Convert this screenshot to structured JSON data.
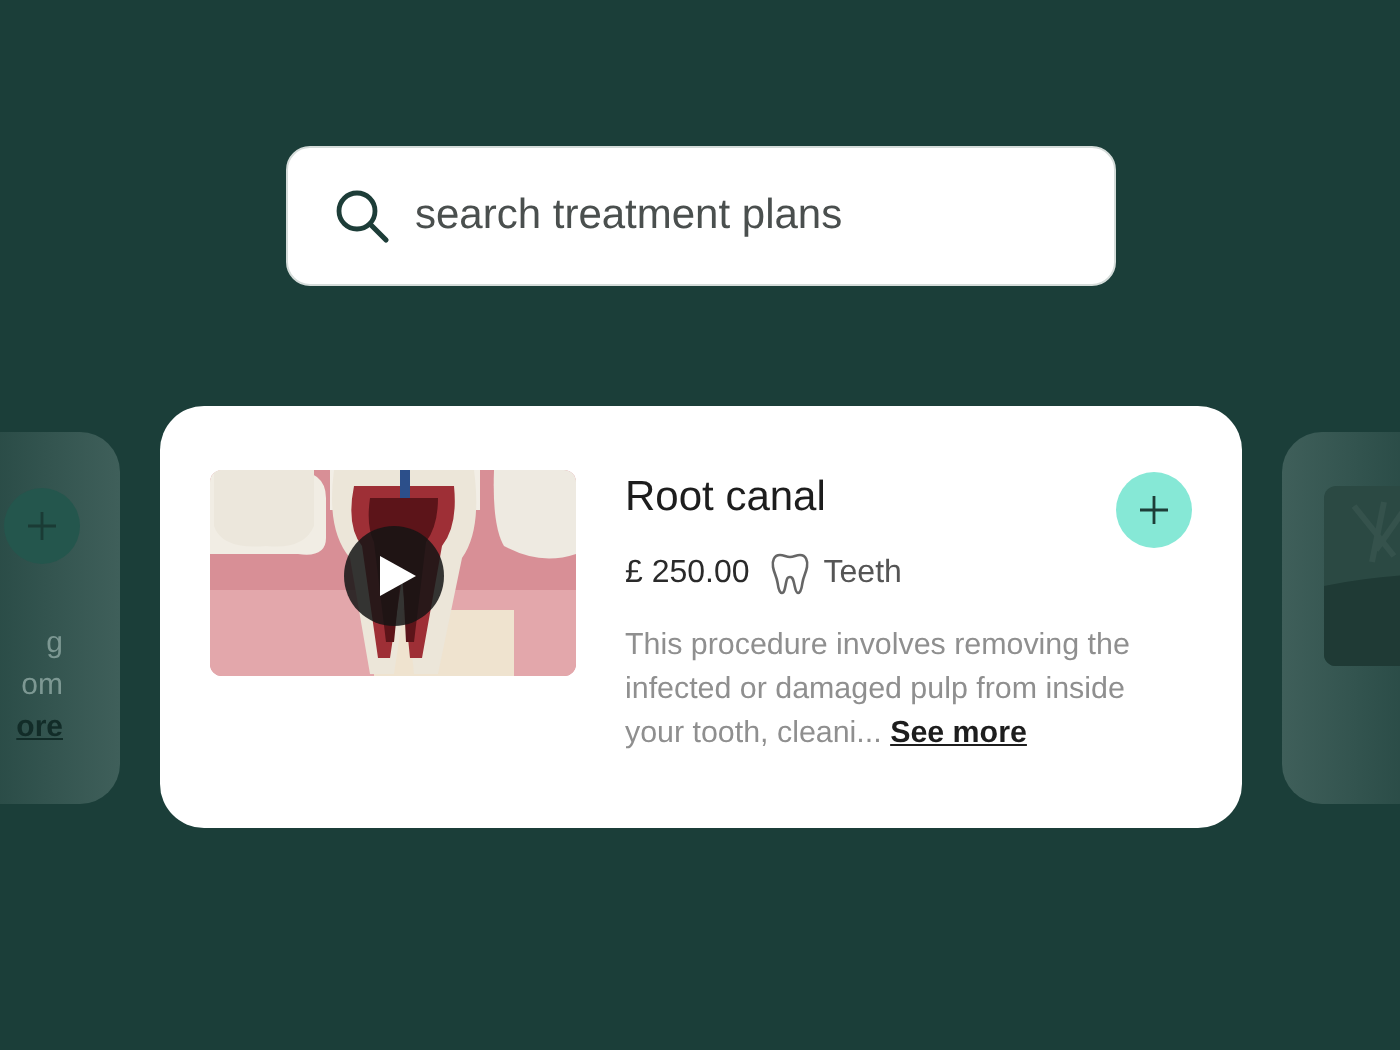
{
  "search": {
    "placeholder": "search treatment plans"
  },
  "cards": [
    {
      "kind": "side-left",
      "lines": [
        "g",
        "om"
      ],
      "link": "ore"
    },
    {
      "kind": "main",
      "title": "Root canal",
      "price": "£ 250.00",
      "category": "Teeth",
      "description": "This procedure involves removing the infected or damaged pulp from inside your tooth, cleani...",
      "link": "See more"
    },
    {
      "kind": "side-right"
    }
  ]
}
